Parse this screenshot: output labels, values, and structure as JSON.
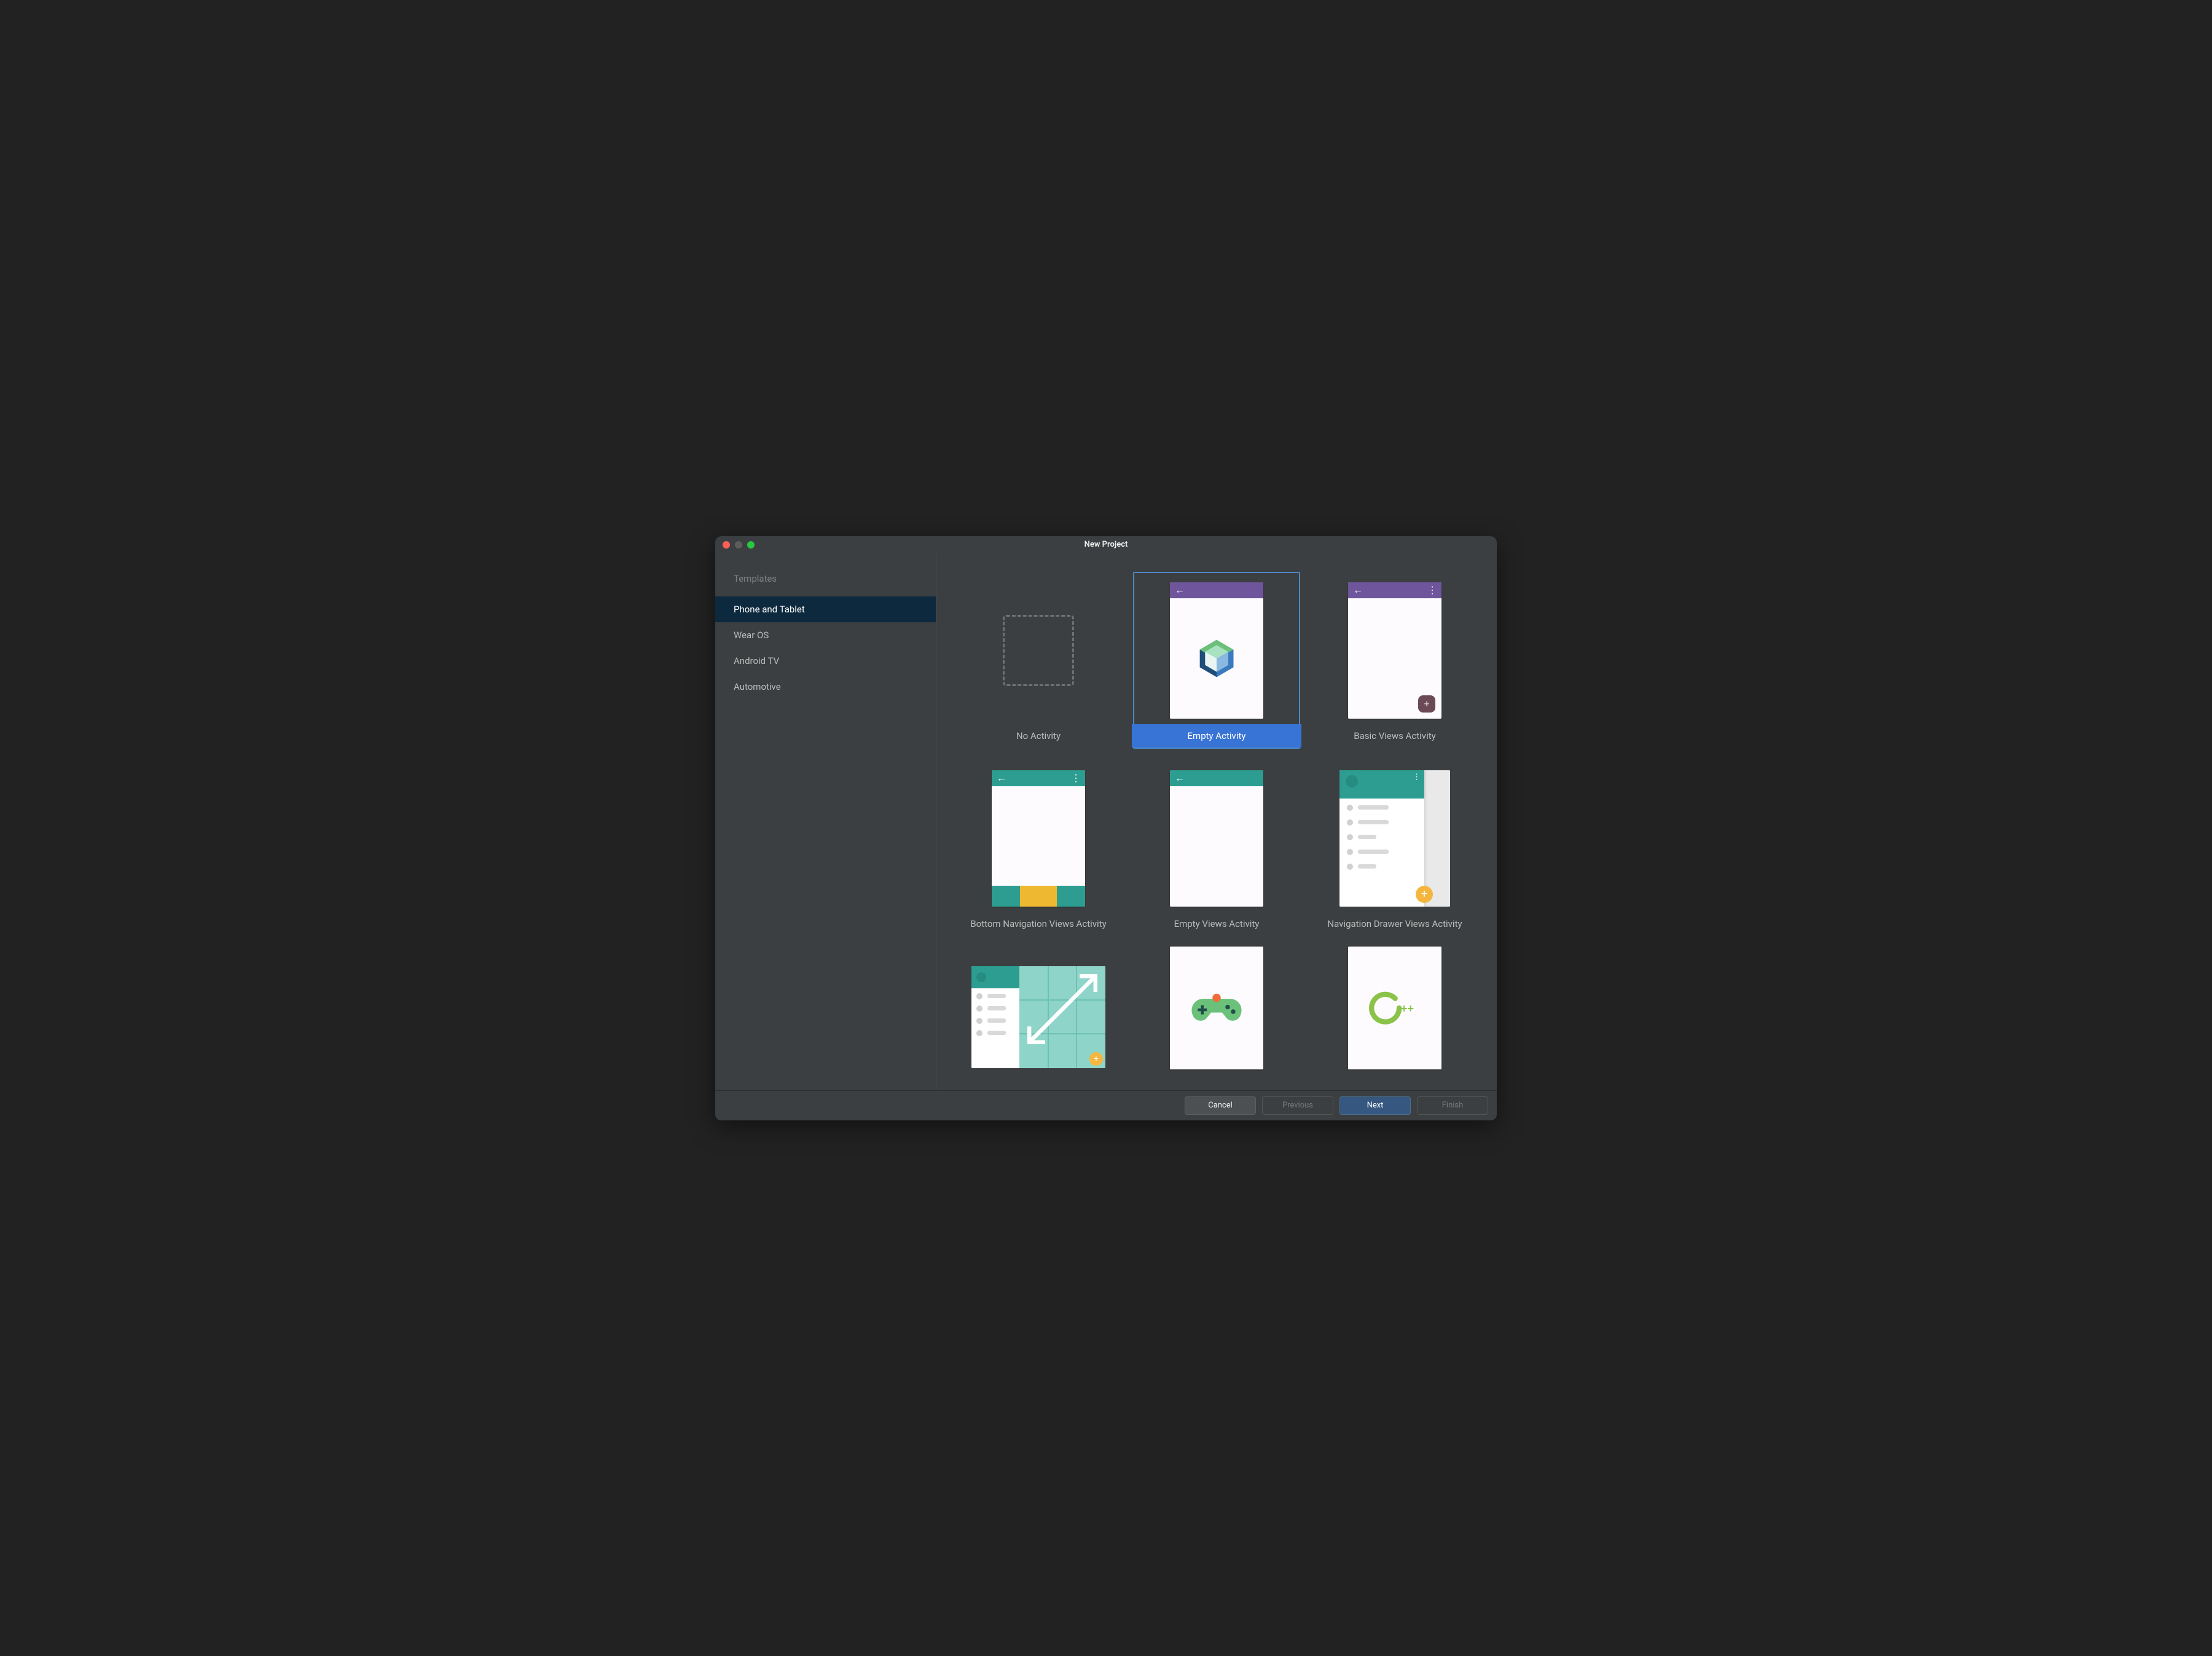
{
  "window": {
    "title": "New Project"
  },
  "sidebar": {
    "header": "Templates",
    "items": [
      {
        "label": "Phone and Tablet",
        "selected": true
      },
      {
        "label": "Wear OS",
        "selected": false
      },
      {
        "label": "Android TV",
        "selected": false
      },
      {
        "label": "Automotive",
        "selected": false
      }
    ]
  },
  "templates": [
    {
      "id": "no-activity",
      "label": "No Activity",
      "selected": false
    },
    {
      "id": "empty-activity",
      "label": "Empty Activity",
      "selected": true
    },
    {
      "id": "basic-views-activity",
      "label": "Basic Views Activity",
      "selected": false
    },
    {
      "id": "bottom-navigation-views-activity",
      "label": "Bottom Navigation Views Activity",
      "selected": false
    },
    {
      "id": "empty-views-activity",
      "label": "Empty Views Activity",
      "selected": false
    },
    {
      "id": "navigation-drawer-views-activity",
      "label": "Navigation Drawer Views Activity",
      "selected": false
    },
    {
      "id": "responsive-views-activity",
      "label": "",
      "selected": false
    },
    {
      "id": "game-activity-cpp",
      "label": "",
      "selected": false
    },
    {
      "id": "native-cpp",
      "label": "",
      "selected": false
    }
  ],
  "footer": {
    "cancel": "Cancel",
    "previous": "Previous",
    "next": "Next",
    "finish": "Finish"
  },
  "colors": {
    "teal": "#2d9d91",
    "purple": "#6e559c",
    "yellow": "#eeb931",
    "selection_blue": "#3874d6"
  }
}
